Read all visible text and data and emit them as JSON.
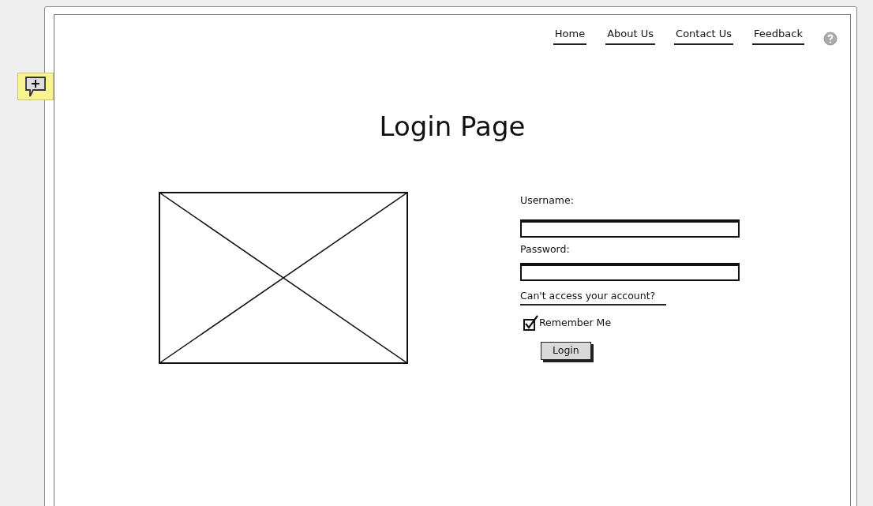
{
  "nav": [
    {
      "label": "Home"
    },
    {
      "label": "About Us"
    },
    {
      "label": "Contact Us"
    },
    {
      "label": "Feedback"
    }
  ],
  "title": "Login Page",
  "form": {
    "fields": [
      {
        "label": "Username:"
      },
      {
        "label": "Password:"
      }
    ],
    "link": "Can't access your account?",
    "remember": {
      "label": "Remember Me",
      "checked": true
    },
    "button": "Login"
  }
}
